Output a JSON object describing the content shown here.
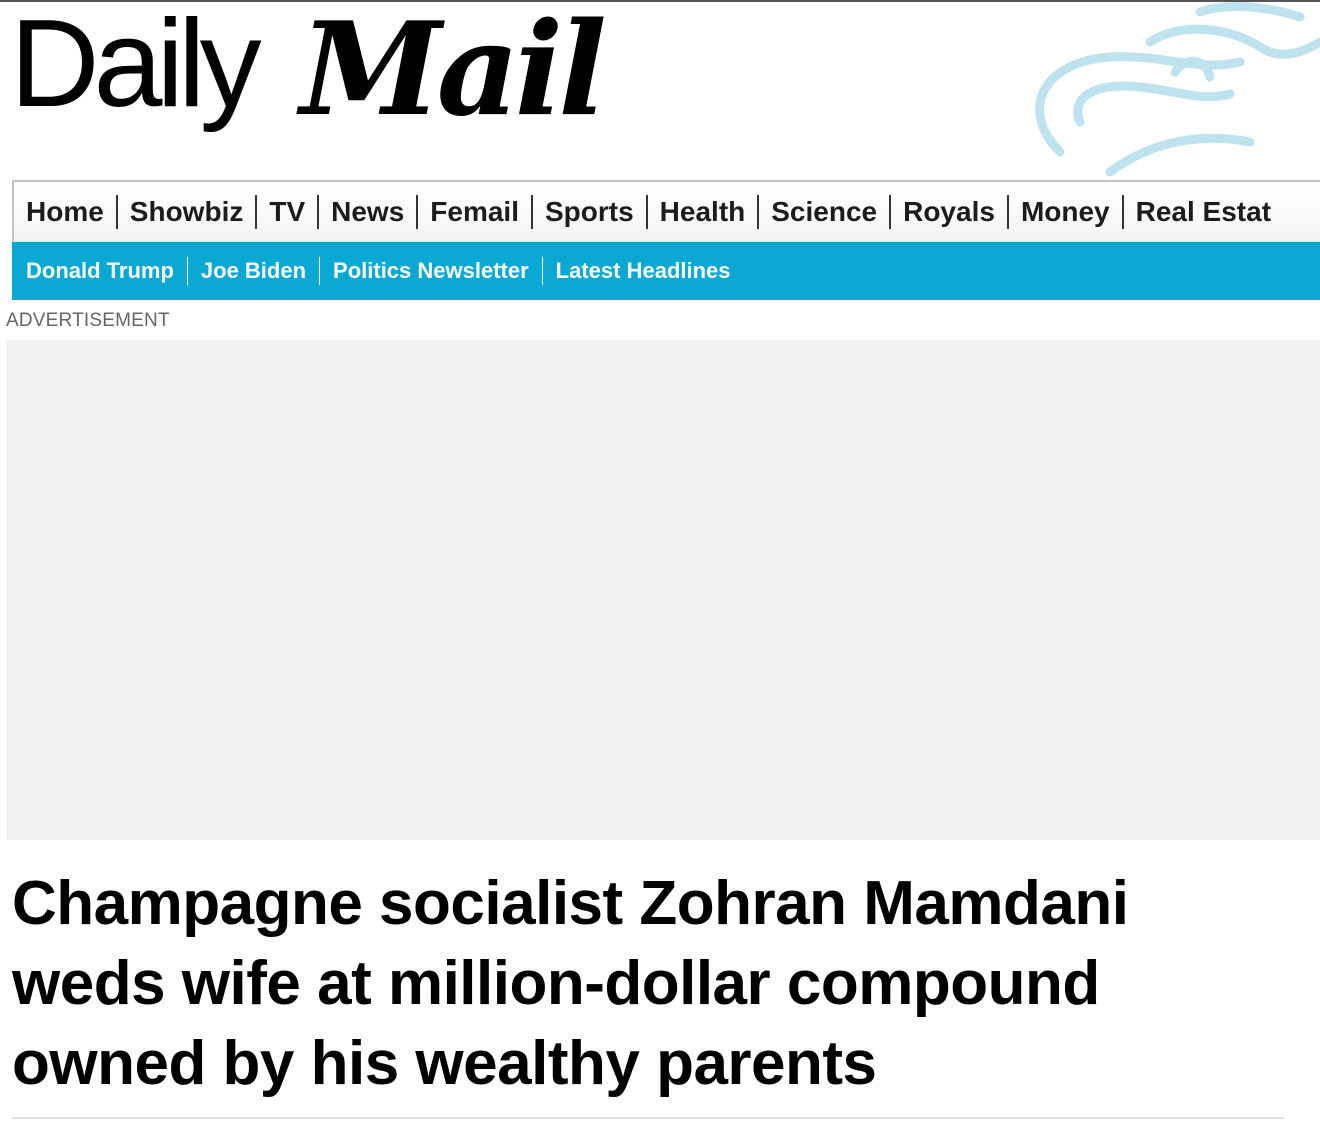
{
  "masthead": {
    "logo_daily": "Daily",
    "logo_mail": "Mail",
    "watermark_icon": "lion-watermark-icon"
  },
  "nav_primary": {
    "items": [
      {
        "label": "Home"
      },
      {
        "label": "Showbiz"
      },
      {
        "label": "TV"
      },
      {
        "label": "News"
      },
      {
        "label": "Femail"
      },
      {
        "label": "Sports"
      },
      {
        "label": "Health"
      },
      {
        "label": "Science"
      },
      {
        "label": "Royals"
      },
      {
        "label": "Money"
      },
      {
        "label": "Real Estat"
      }
    ]
  },
  "nav_secondary": {
    "items": [
      {
        "label": "Donald Trump"
      },
      {
        "label": "Joe Biden"
      },
      {
        "label": "Politics Newsletter"
      },
      {
        "label": "Latest Headlines"
      }
    ]
  },
  "ad": {
    "label": "ADVERTISEMENT"
  },
  "article": {
    "headline": "Champagne socialist Zohran Mamdani weds wife at million-dollar compound owned by his wealthy parents"
  },
  "colors": {
    "secondary_nav": "#08a8d2",
    "watermark": "#bfe3ee",
    "ad_background": "#f1f1f1"
  }
}
